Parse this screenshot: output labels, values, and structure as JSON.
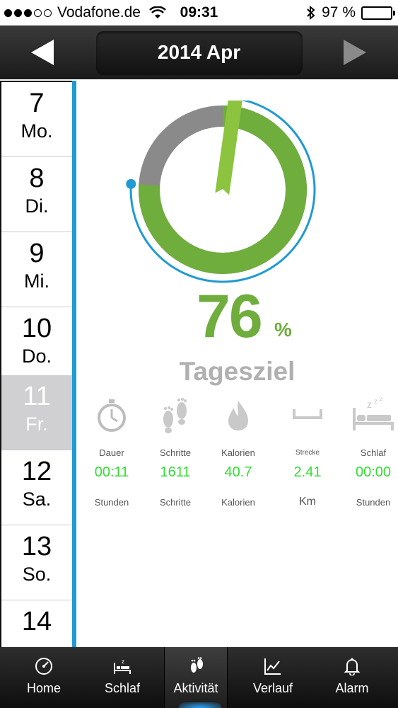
{
  "status": {
    "carrier": "Vodafone.de",
    "time": "09:31",
    "battery": "97 %"
  },
  "nav": {
    "title": "2014 Apr"
  },
  "days": [
    {
      "num": "7",
      "wd": "Mo."
    },
    {
      "num": "8",
      "wd": "Di."
    },
    {
      "num": "9",
      "wd": "Mi."
    },
    {
      "num": "10",
      "wd": "Do."
    },
    {
      "num": "11",
      "wd": "Fr."
    },
    {
      "num": "12",
      "wd": "Sa."
    },
    {
      "num": "13",
      "wd": "So."
    },
    {
      "num": "14",
      "wd": ""
    }
  ],
  "selected_day": 4,
  "goal": {
    "value": "76",
    "unit": "%",
    "label": "Tagesziel",
    "progress_percent": 76
  },
  "stats": {
    "dauer": {
      "label": "Dauer",
      "value": "00:11",
      "unit": "Stunden"
    },
    "schritte": {
      "label": "Schritte",
      "value": "1611",
      "unit": "Schritte"
    },
    "kalorien": {
      "label": "Kalorien",
      "value": "40.7",
      "unit": "Kalorien"
    },
    "strecke": {
      "label": "Strecke",
      "value": "2.41",
      "unit": "Km"
    },
    "schlaf": {
      "label": "Schlaf",
      "value": "00:00",
      "unit": "Stunden"
    }
  },
  "tabs": {
    "home": "Home",
    "schlaf": "Schlaf",
    "aktivitaet": "Aktivität",
    "verlauf": "Verlauf",
    "alarm": "Alarm"
  },
  "colors": {
    "green": "#6fad3d",
    "value_green": "#33dd33",
    "blue": "#1f9bd1",
    "gray": "#8a8a8a"
  },
  "icons": [
    "stopwatch-icon",
    "footprints-icon",
    "flame-icon",
    "distance-icon",
    "bed-icon",
    "speedometer-icon",
    "chart-icon",
    "bell-icon"
  ]
}
